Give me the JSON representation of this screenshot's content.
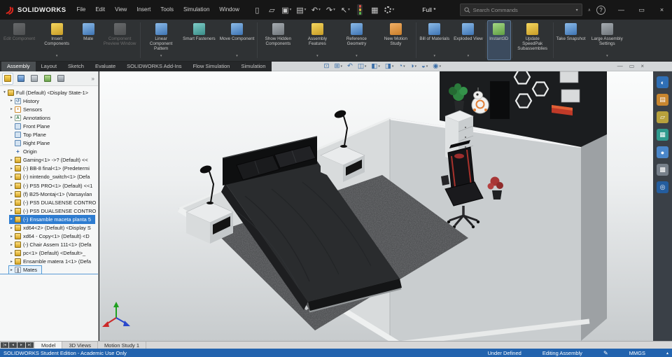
{
  "colors": {
    "selection_blue": "#2e7cd0",
    "statusbar_blue": "#2263ae",
    "brand_red": "#d9261c"
  },
  "titlebar": {
    "app_name": "SOLIDWORKS",
    "menus": [
      "File",
      "Edit",
      "View",
      "Insert",
      "Tools",
      "Simulation",
      "Window"
    ],
    "toolbar_icons": [
      {
        "name": "new-document-icon",
        "glyph": "▯"
      },
      {
        "name": "open-document-icon",
        "glyph": "▱"
      },
      {
        "name": "save-icon",
        "glyph": "▣",
        "arrow": true
      },
      {
        "name": "print-icon",
        "glyph": "▤",
        "arrow": true
      },
      {
        "name": "undo-icon",
        "glyph": "↶",
        "arrow": true
      },
      {
        "name": "redo-icon",
        "glyph": "↷",
        "arrow": true
      },
      {
        "name": "select-icon",
        "glyph": "↖",
        "arrow": true
      },
      {
        "name": "rebuild-traffic-light-icon",
        "traffic": true
      },
      {
        "name": "file-properties-icon",
        "glyph": "▦"
      },
      {
        "name": "options-gear-icon",
        "gear": true,
        "arrow": true
      }
    ],
    "document_title": "Full *",
    "search": {
      "placeholder": "Search Commands"
    },
    "collapse_glyph": "∧",
    "window_controls": [
      {
        "name": "minimize-button",
        "glyph": "—"
      },
      {
        "name": "restore-button",
        "glyph": "▭"
      },
      {
        "name": "close-button",
        "glyph": "×"
      }
    ]
  },
  "ribbon": {
    "active_tab": "Assembly",
    "buttons": [
      {
        "label": "Edit Component",
        "icon": "edit-component-icon",
        "ic": "gray",
        "disabled": true
      },
      {
        "label": "Insert Components",
        "icon": "insert-components-icon",
        "ic": "yellow",
        "arrow": true
      },
      {
        "label": "Mate",
        "icon": "mate-icon",
        "ic": "blue"
      },
      {
        "label": "Component Preview Window",
        "icon": "component-preview-window-icon",
        "ic": "gray",
        "disabled": true
      },
      {
        "label": "Linear Component Pattern",
        "icon": "linear-component-pattern-icon",
        "ic": "blue",
        "arrow": true,
        "sep_before": true
      },
      {
        "label": "Smart Fasteners",
        "icon": "smart-fasteners-icon",
        "ic": "teal"
      },
      {
        "label": "Move Component",
        "icon": "move-component-icon",
        "ic": "blue",
        "arrow": true
      },
      {
        "label": "Show Hidden Components",
        "icon": "show-hidden-components-icon",
        "ic": "gray",
        "sep_before": true
      },
      {
        "label": "Assembly Features",
        "icon": "assembly-features-icon",
        "ic": "yellow",
        "arrow": true
      },
      {
        "label": "Reference Geometry",
        "icon": "reference-geometry-icon",
        "ic": "blue",
        "arrow": true
      },
      {
        "label": "New Motion Study",
        "icon": "new-motion-study-icon",
        "ic": "orange"
      },
      {
        "label": "Bill of Materials",
        "icon": "bill-of-materials-icon",
        "ic": "blue",
        "arrow": true,
        "sep_before": true
      },
      {
        "label": "Exploded View",
        "icon": "exploded-view-icon",
        "ic": "blue",
        "arrow": true
      },
      {
        "label": "Instant3D",
        "icon": "instant3d-icon",
        "ic": "green",
        "active": true,
        "sep_before": true
      },
      {
        "label": "Update SpeedPak Subassemblies",
        "icon": "update-speedpak-icon",
        "ic": "yellow",
        "sep_before": true
      },
      {
        "label": "Take Snapshot",
        "icon": "take-snapshot-icon",
        "ic": "blue",
        "sep_before": true
      },
      {
        "label": "Large Assembly Settings",
        "icon": "large-assembly-settings-icon",
        "ic": "gray",
        "arrow": true
      }
    ]
  },
  "command_tabs": [
    "Assembly",
    "Layout",
    "Sketch",
    "Evaluate",
    "SOLIDWORKS Add-Ins",
    "Flow Simulation",
    "Simulation"
  ],
  "hud": [
    {
      "name": "zoom-to-fit-icon",
      "glyph": "⊡"
    },
    {
      "name": "zoom-to-area-icon",
      "glyph": "⊞",
      "arrow": true
    },
    {
      "name": "previous-view-icon",
      "glyph": "↶"
    },
    {
      "name": "section-view-icon",
      "glyph": "◫",
      "arrow": true
    },
    {
      "name": "view-orientation-icon",
      "glyph": "◧",
      "arrow": true
    },
    {
      "name": "display-style-icon",
      "glyph": "◨",
      "arrow": true
    },
    {
      "name": "hide-show-items-icon",
      "glyph": "◔",
      "arrow": true
    },
    {
      "name": "edit-appearance-icon",
      "glyph": "◑",
      "arrow": true
    },
    {
      "name": "apply-scene-icon",
      "glyph": "◒",
      "arrow": true
    },
    {
      "name": "view-settings-icon",
      "glyph": "◉",
      "arrow": true
    }
  ],
  "document_controls": [
    {
      "name": "document-minimize-button",
      "glyph": "—"
    },
    {
      "name": "document-restore-button",
      "glyph": "▭"
    },
    {
      "name": "document-close-button",
      "glyph": "×"
    }
  ],
  "manager_tabs": [
    {
      "name": "featuremanager-tree-tab",
      "cls": "mt-yellow",
      "active": true
    },
    {
      "name": "propertymanager-tab",
      "cls": "mt-blue"
    },
    {
      "name": "configurationmanager-tab",
      "cls": "mt-stack"
    },
    {
      "name": "dimxpertmanager-tab",
      "cls": "mt-green"
    },
    {
      "name": "displaymanager-tab",
      "cls": "mt-gray"
    }
  ],
  "manager_more_glyph": "»",
  "tree": {
    "items": [
      {
        "label": "Full (Default) <Display State-1>",
        "icon": "asm",
        "indent": 0,
        "arrow": "down"
      },
      {
        "label": "History",
        "icon": "history",
        "indent": 1,
        "arrow": "right"
      },
      {
        "label": "Sensors",
        "icon": "sensors",
        "indent": 1,
        "arrow": "right"
      },
      {
        "label": "Annotations",
        "icon": "anno",
        "indent": 1,
        "arrow": "right"
      },
      {
        "label": "Front Plane",
        "icon": "plane",
        "indent": 1,
        "arrow": "none"
      },
      {
        "label": "Top Plane",
        "icon": "plane",
        "indent": 1,
        "arrow": "none"
      },
      {
        "label": "Right Plane",
        "icon": "plane",
        "indent": 1,
        "arrow": "none"
      },
      {
        "label": "Origin",
        "icon": "origin",
        "indent": 1,
        "arrow": "none"
      },
      {
        "label": "Gaming<1> ->? (Default) <<",
        "icon": "asm",
        "indent": 1,
        "arrow": "right"
      },
      {
        "label": "(-) BB-8 final<1> (Predetermi",
        "icon": "asm",
        "indent": 1,
        "arrow": "right"
      },
      {
        "label": "(-) nintendo_switch<1> (Defa",
        "icon": "asm",
        "indent": 1,
        "arrow": "right"
      },
      {
        "label": "(-) PS5 PRO<1> (Default) <<1",
        "icon": "asm",
        "indent": 1,
        "arrow": "right"
      },
      {
        "label": "(f) B25-Montaj<1> (Varsayılan",
        "icon": "asm",
        "indent": 1,
        "arrow": "right"
      },
      {
        "label": "(-) PS5 DUALSENSE CONTRO",
        "icon": "asm",
        "indent": 1,
        "arrow": "right"
      },
      {
        "label": "(-) PS5 DUALSENSE CONTRO",
        "icon": "asm",
        "indent": 1,
        "arrow": "right"
      },
      {
        "label": "(-) Ensamble maceta planta 5",
        "icon": "asm",
        "indent": 1,
        "arrow": "right",
        "selected": true
      },
      {
        "label": "xd64<2> (Default) <Display S",
        "icon": "asm",
        "indent": 1,
        "arrow": "right"
      },
      {
        "label": "xd64 - Copy<1> (Default) <D",
        "icon": "asm",
        "indent": 1,
        "arrow": "right"
      },
      {
        "label": "(-) Chair Assem 111<1> (Defa",
        "icon": "asm",
        "indent": 1,
        "arrow": "right"
      },
      {
        "label": "pc<1> (Default) <Default>_",
        "icon": "asm",
        "indent": 1,
        "arrow": "right"
      },
      {
        "label": "Ensamble matera 1<1> (Defa",
        "icon": "asm",
        "indent": 1,
        "arrow": "right"
      },
      {
        "label": "Mates",
        "icon": "mates",
        "indent": 1,
        "arrow": "right",
        "boxed": true
      }
    ]
  },
  "task_pane": [
    {
      "name": "solidworks-resources-icon",
      "cls": "tp-blue",
      "glyph": "◐"
    },
    {
      "name": "design-library-icon",
      "cls": "tp-orange",
      "glyph": "▤"
    },
    {
      "name": "file-explorer-icon",
      "cls": "tp-yellow",
      "glyph": "▱"
    },
    {
      "name": "view-palette-icon",
      "cls": "tp-teal",
      "glyph": "▦"
    },
    {
      "name": "appearances-scenes-icon",
      "cls": "tp-blue2",
      "glyph": "●"
    },
    {
      "name": "custom-properties-icon",
      "cls": "tp-gray",
      "glyph": "▩"
    },
    {
      "name": "solidworks-forum-icon",
      "cls": "tp-blue3",
      "glyph": "◎"
    }
  ],
  "bottom_tabs": {
    "nav": [
      "|◂",
      "◂",
      "▸",
      "▸|"
    ],
    "items": [
      "Model",
      "3D Views",
      "Motion Study 1"
    ],
    "active_index": 0
  },
  "statusbar": {
    "left_text": "SOLIDWORKS Student Edition - Academic Use Only",
    "definition_status": "Under Defined",
    "mode": "Editing Assembly",
    "edit_glyph": "✎",
    "units": "MMGS",
    "expand_glyph": "▴"
  }
}
